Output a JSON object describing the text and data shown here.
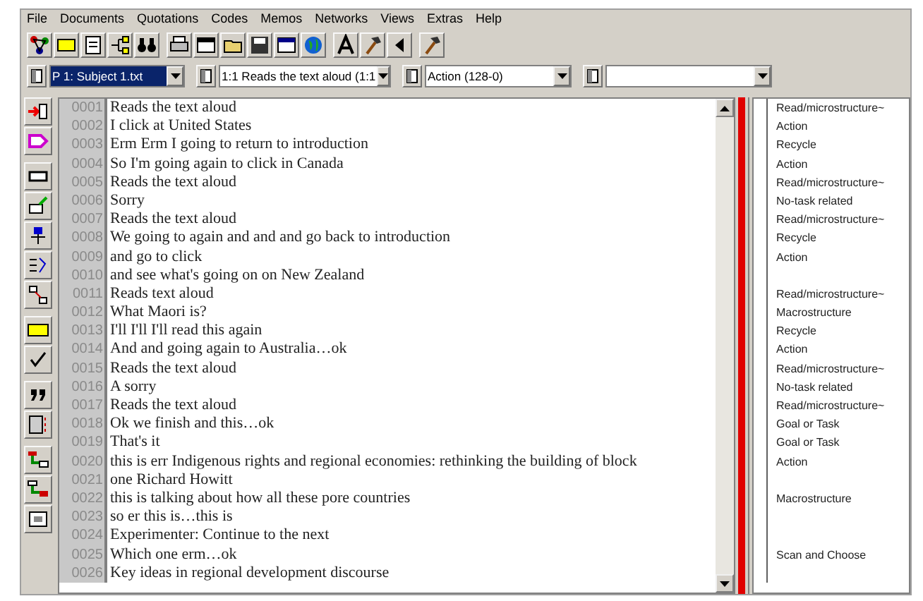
{
  "menu": [
    "File",
    "Documents",
    "Quotations",
    "Codes",
    "Memos",
    "Networks",
    "Views",
    "Extras",
    "Help"
  ],
  "selectors": [
    {
      "value": "P 1: Subject 1.txt",
      "highlighted": true
    },
    {
      "value": "1:1 Reads the text aloud (1:1",
      "highlighted": false
    },
    {
      "value": "Action (128-0)",
      "highlighted": false
    },
    {
      "highlighted": false
    }
  ],
  "lines": [
    {
      "number": "0001",
      "text": "Reads the text aloud"
    },
    {
      "number": "0002",
      "text": "I click at United States"
    },
    {
      "number": "0003",
      "text": "Erm  Erm  I going to return to introduction"
    },
    {
      "number": "0004",
      "text": "So I'm going again to click in Canada"
    },
    {
      "number": "0005",
      "text": "Reads the text aloud"
    },
    {
      "number": "0006",
      "text": "Sorry"
    },
    {
      "number": "0007",
      "text": "Reads the text aloud"
    },
    {
      "number": "0008",
      "text": "We going to again and and and go back to introduction"
    },
    {
      "number": "0009",
      "text": "and go to click"
    },
    {
      "number": "0010",
      "text": "and see what's going on on New Zealand"
    },
    {
      "number": "0011",
      "text": "Reads text aloud"
    },
    {
      "number": "0012",
      "text": "What Maori is?"
    },
    {
      "number": "0013",
      "text": "I'll I'll I'll read this again"
    },
    {
      "number": "0014",
      "text": "And and going again to Australia…ok"
    },
    {
      "number": "0015",
      "text": "Reads the text aloud"
    },
    {
      "number": "0016",
      "text": "A sorry"
    },
    {
      "number": "0017",
      "text": "Reads the text aloud"
    },
    {
      "number": "0018",
      "text": "Ok we finish and this…ok"
    },
    {
      "number": "0019",
      "text": "That's it"
    },
    {
      "number": "0020",
      "text": "this is err  Indigenous rights and regional economies: rethinking the building of block"
    },
    {
      "number": "0021",
      "text": "one Richard Howitt"
    },
    {
      "number": "0022",
      "text": "this is  talking about how all these pore countries"
    },
    {
      "number": "0023",
      "text": "so er this is…this is"
    },
    {
      "number": "0024",
      "text": "Experimenter: Continue to the next"
    },
    {
      "number": "0025",
      "text": "Which one erm…ok"
    },
    {
      "number": "0026",
      "text": "Key ideas in regional development discourse"
    }
  ],
  "margin_codes": [
    {
      "kind": "code",
      "label": "Read/microstructure~"
    },
    {
      "kind": "code",
      "label": "Action"
    },
    {
      "kind": "code",
      "label": "Recycle"
    },
    {
      "kind": "code",
      "label": "Action"
    },
    {
      "kind": "code",
      "label": "Read/microstructure~"
    },
    {
      "kind": "code",
      "label": "No-task related"
    },
    {
      "kind": "code",
      "label": "Read/microstructure~"
    },
    {
      "kind": "code",
      "label": "Recycle"
    },
    {
      "kind": "code",
      "label": "Action"
    },
    {
      "kind": "blank"
    },
    {
      "kind": "code",
      "label": "Read/microstructure~"
    },
    {
      "kind": "code",
      "label": "Macrostructure"
    },
    {
      "kind": "code",
      "label": "Recycle"
    },
    {
      "kind": "code",
      "label": "Action"
    },
    {
      "kind": "code",
      "label": "Read/microstructure~"
    },
    {
      "kind": "code",
      "label": "No-task related"
    },
    {
      "kind": "code",
      "label": "Read/microstructure~"
    },
    {
      "kind": "code",
      "label": "Goal or Task"
    },
    {
      "kind": "code",
      "label": "Goal or Task"
    },
    {
      "kind": "code",
      "label": "Action"
    },
    {
      "kind": "blank"
    },
    {
      "kind": "code",
      "label": "Macrostructure"
    },
    {
      "kind": "blank"
    },
    {
      "kind": "blank"
    },
    {
      "kind": "code",
      "label": "Scan and Choose"
    },
    {
      "kind": "blank"
    }
  ]
}
